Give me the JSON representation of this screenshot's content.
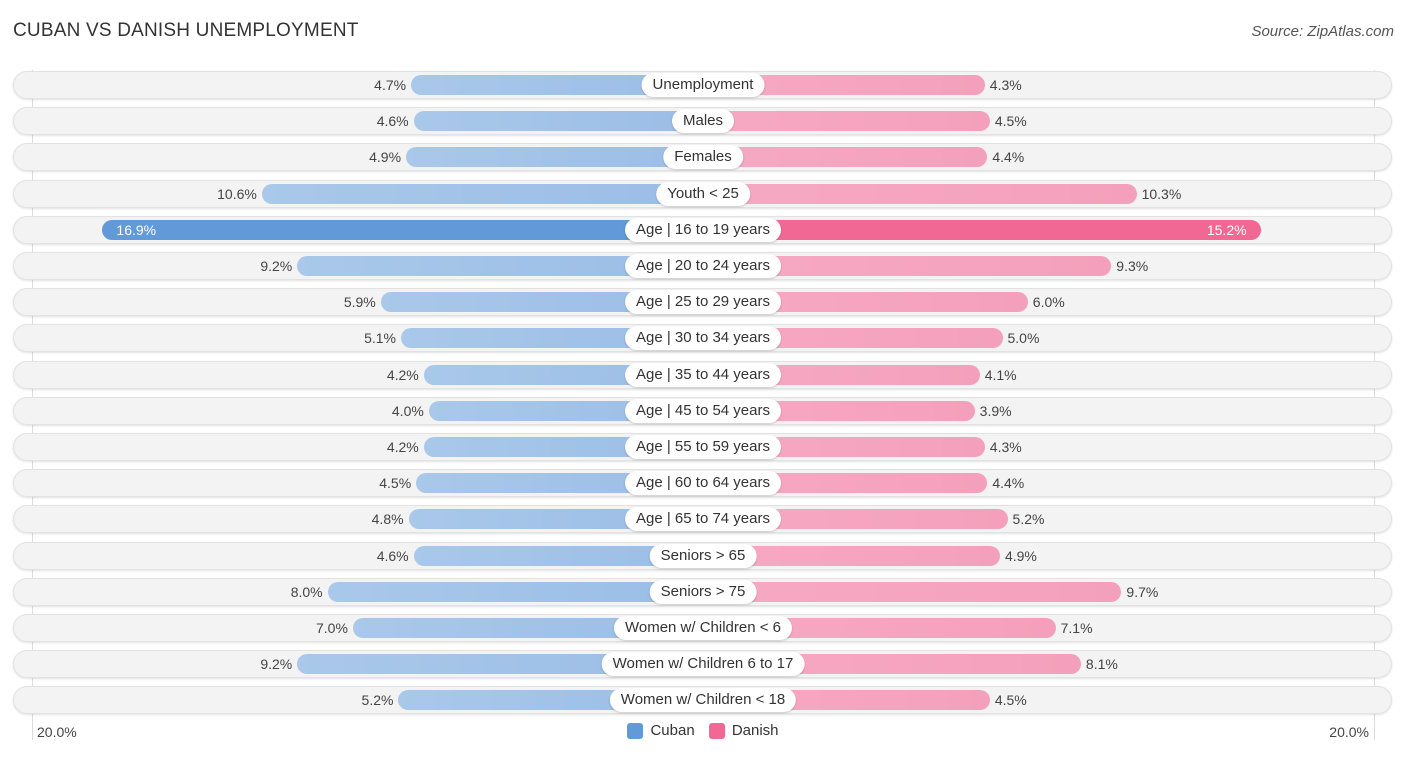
{
  "header": {
    "title": "CUBAN VS DANISH UNEMPLOYMENT",
    "source": "Source: ZipAtlas.com"
  },
  "chart_data": {
    "type": "bar",
    "orientation": "horizontal-diverging",
    "title": "CUBAN VS DANISH UNEMPLOYMENT",
    "xlabel": "",
    "ylabel": "",
    "xlim": [
      0,
      20.0
    ],
    "axis_labels": {
      "left": "20.0%",
      "right": "20.0%"
    },
    "legend": {
      "position": "bottom-center",
      "entries": [
        "Cuban",
        "Danish"
      ]
    },
    "colors": {
      "Cuban": "#a4c4e8",
      "Cuban_highlight": "#6199d9",
      "Danish": "#f5a7c1",
      "Danish_highlight": "#f06893"
    },
    "categories": [
      "Unemployment",
      "Males",
      "Females",
      "Youth < 25",
      "Age | 16 to 19 years",
      "Age | 20 to 24 years",
      "Age | 25 to 29 years",
      "Age | 30 to 34 years",
      "Age | 35 to 44 years",
      "Age | 45 to 54 years",
      "Age | 55 to 59 years",
      "Age | 60 to 64 years",
      "Age | 65 to 74 years",
      "Seniors > 65",
      "Seniors > 75",
      "Women w/ Children < 6",
      "Women w/ Children 6 to 17",
      "Women w/ Children < 18"
    ],
    "series": [
      {
        "name": "Cuban",
        "values": [
          4.7,
          4.6,
          4.9,
          10.6,
          16.9,
          9.2,
          5.9,
          5.1,
          4.2,
          4.0,
          4.2,
          4.5,
          4.8,
          4.6,
          8.0,
          7.0,
          9.2,
          5.2
        ],
        "labels": [
          "4.7%",
          "4.6%",
          "4.9%",
          "10.6%",
          "16.9%",
          "9.2%",
          "5.9%",
          "5.1%",
          "4.2%",
          "4.0%",
          "4.2%",
          "4.5%",
          "4.8%",
          "4.6%",
          "8.0%",
          "7.0%",
          "9.2%",
          "5.2%"
        ]
      },
      {
        "name": "Danish",
        "values": [
          4.3,
          4.5,
          4.4,
          10.3,
          15.2,
          9.3,
          6.0,
          5.0,
          4.1,
          3.9,
          4.3,
          4.4,
          5.2,
          4.9,
          9.7,
          7.1,
          8.1,
          4.5
        ],
        "labels": [
          "4.3%",
          "4.5%",
          "4.4%",
          "10.3%",
          "15.2%",
          "9.3%",
          "6.0%",
          "5.0%",
          "4.1%",
          "3.9%",
          "4.3%",
          "4.4%",
          "5.2%",
          "4.9%",
          "9.7%",
          "7.1%",
          "8.1%",
          "4.5%"
        ]
      }
    ],
    "highlighted_category": "Age | 16 to 19 years"
  }
}
